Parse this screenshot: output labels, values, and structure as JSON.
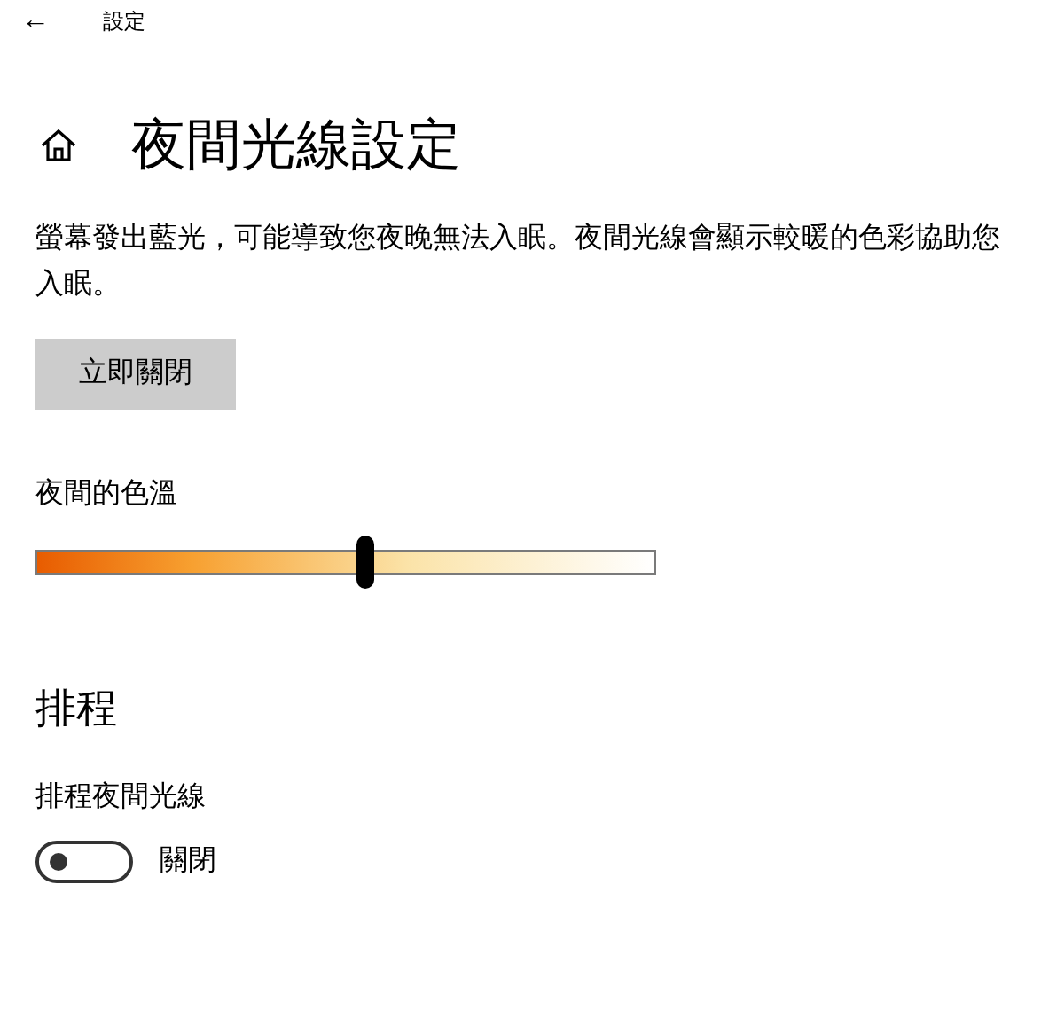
{
  "header": {
    "back": "←",
    "title": "設定"
  },
  "page": {
    "title": "夜間光線設定",
    "description": "螢幕發出藍光，可能導致您夜晚無法入眠。夜間光線會顯示較暖的色彩協助您入眠。",
    "button": "立即關閉"
  },
  "color_temperature": {
    "label": "夜間的色溫",
    "level": 0.53
  },
  "schedule": {
    "heading": "排程",
    "label": "排程夜間光線",
    "on": false,
    "state_text": "關閉"
  }
}
